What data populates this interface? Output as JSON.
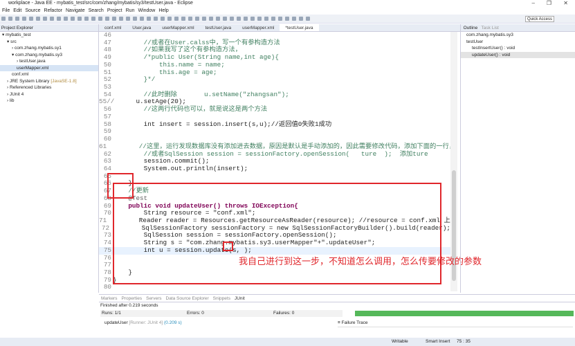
{
  "window": {
    "title": "workplace - Java EE - mybatis_test/src/com/zhang/mybatis/sy3/testUser.java - Eclipse"
  },
  "menu": [
    "File",
    "Edit",
    "Source",
    "Refactor",
    "Navigate",
    "Search",
    "Project",
    "Run",
    "Window",
    "Help"
  ],
  "quick_access": "Quick Access",
  "project_explorer": {
    "title": "Project Explorer",
    "items": [
      {
        "label": "mybatis_test",
        "indent": 0,
        "arrow": "▾"
      },
      {
        "label": "src",
        "indent": 1,
        "arrow": "▾"
      },
      {
        "label": "com.zhang.mybatis.sy1",
        "indent": 2,
        "arrow": "›"
      },
      {
        "label": "com.zhang.mybatis.sy3",
        "indent": 2,
        "arrow": "▾"
      },
      {
        "label": "testUser.java",
        "indent": 3,
        "arrow": "›"
      },
      {
        "label": "userMapper.xml",
        "indent": 3,
        "arrow": "",
        "selected": true
      },
      {
        "label": "conf.xml",
        "indent": 2,
        "arrow": ""
      },
      {
        "label": "JRE System Library",
        "suffix": "[JavaSE-1.8]",
        "indent": 1,
        "arrow": "›"
      },
      {
        "label": "Referenced Libraries",
        "indent": 1,
        "arrow": "›"
      },
      {
        "label": "JUnit 4",
        "indent": 1,
        "arrow": "›"
      },
      {
        "label": "lib",
        "indent": 1,
        "arrow": "›"
      }
    ]
  },
  "editor": {
    "tabs": [
      "conf.xml",
      "User.java",
      "userMapper.xml",
      "testUser.java",
      "userMapper.xml",
      "*testUser.java"
    ],
    "active_tab": 5,
    "lines": [
      {
        "n": "46",
        "t": "",
        "s": "c"
      },
      {
        "n": "47",
        "t": "        //或者在User.calss中，写一个有参构造方法",
        "s": "c"
      },
      {
        "n": "48",
        "t": "        //如果我写了这个有参构造方法，",
        "s": "c"
      },
      {
        "n": "49",
        "t": "        /*public User(String name,int age){",
        "s": "c"
      },
      {
        "n": "50",
        "t": "            this.name = name;",
        "s": "c"
      },
      {
        "n": "51",
        "t": "            this.age = age;",
        "s": "c"
      },
      {
        "n": "52",
        "t": "        }*/",
        "s": "c"
      },
      {
        "n": "53",
        "t": "",
        "s": ""
      },
      {
        "n": "54",
        "t": "        //此时删除       u.setName(\"zhangsan\");",
        "s": "c"
      },
      {
        "n": "55//",
        "t": "      u.setAge(20);",
        "s": ""
      },
      {
        "n": "56",
        "t": "        //这两行代码也可以，就是说这是两个方法",
        "s": "c"
      },
      {
        "n": "57",
        "t": "",
        "s": ""
      },
      {
        "n": "58",
        "t": "        int insert = session.insert(s,u);//返回值0失败1成功",
        "s": ""
      },
      {
        "n": "59",
        "t": "",
        "s": ""
      },
      {
        "n": "60",
        "t": "",
        "s": ""
      },
      {
        "n": "61",
        "t": "        //这里，运行发现数据库没有添加进去数据，原因是默认是手动添加的，因此需要修改代码，添加下面的一行，",
        "s": "c"
      },
      {
        "n": "62",
        "t": "        //或者SqlSession session = sessionFactory.openSession(   ture  );  添加ture",
        "s": "c"
      },
      {
        "n": "63",
        "t": "        session.commit();",
        "s": ""
      },
      {
        "n": "64",
        "t": "        System.out.println(insert);",
        "s": ""
      },
      {
        "n": "65",
        "t": "",
        "s": ""
      },
      {
        "n": "66",
        "t": "    }",
        "s": ""
      },
      {
        "n": "67",
        "t": "    //更新",
        "s": "c"
      },
      {
        "n": "68",
        "t": "    @Test",
        "s": "a"
      },
      {
        "n": "69",
        "t": "    public void updateUser() throws IOException{",
        "s": "k"
      },
      {
        "n": "70",
        "t": "        String resource = \"conf.xml\";",
        "s": ""
      },
      {
        "n": "71",
        "t": "        Reader reader = Resources.getResourceAsReader(resource); //resource = conf.xml 上一行",
        "s": ""
      },
      {
        "n": "72",
        "t": "        SqlSessionFactory sessionFactory = new SqlSessionFactoryBuilder().build(reader);",
        "s": ""
      },
      {
        "n": "73",
        "t": "        SqlSession session = sessionFactory.openSession();",
        "s": ""
      },
      {
        "n": "74",
        "t": "        String s = \"com.zhang.mybatis.sy3.userMapper\"+\".updateUser\";",
        "s": ""
      },
      {
        "n": "75",
        "t": "        int u = session.update(s, );",
        "s": "cur"
      },
      {
        "n": "76",
        "t": "",
        "s": ""
      },
      {
        "n": "77",
        "t": "",
        "s": ""
      },
      {
        "n": "78",
        "t": "    }",
        "s": ""
      },
      {
        "n": "79",
        "t": "}",
        "s": ""
      },
      {
        "n": "80",
        "t": "",
        "s": ""
      }
    ]
  },
  "annotation": "我自己进行到这一步，不知道怎么调用，怎么传要修改的参数",
  "outline": {
    "tabs": [
      "Outline",
      "Task List"
    ],
    "items": [
      {
        "label": "com.zhang.mybatis.sy3",
        "indent": 0
      },
      {
        "label": "testUser",
        "indent": 0
      },
      {
        "label": "testInsertUser() : void",
        "indent": 1
      },
      {
        "label": "updateUser() : void",
        "indent": 1,
        "selected": true
      }
    ]
  },
  "bottom": {
    "tabs": [
      "Markers",
      "Properties",
      "Servers",
      "Data Source Explorer",
      "Snippets",
      "JUnit"
    ],
    "finished": "Finished after 0.219 seconds",
    "runs": "Runs:  1/1",
    "errors": "Errors:  0",
    "failures": "Failures:  0",
    "progress": 1.0,
    "test": "updateUser",
    "test_runner": "[Runner: JUnit 4]",
    "test_time": "(0.209 s)",
    "failure_trace": "Failure Trace"
  },
  "status": {
    "writable": "Writable",
    "insert": "Smart Insert",
    "position": "75 : 35"
  },
  "colors": {
    "annotation": "#e0262b",
    "progress": "#55b85a"
  }
}
